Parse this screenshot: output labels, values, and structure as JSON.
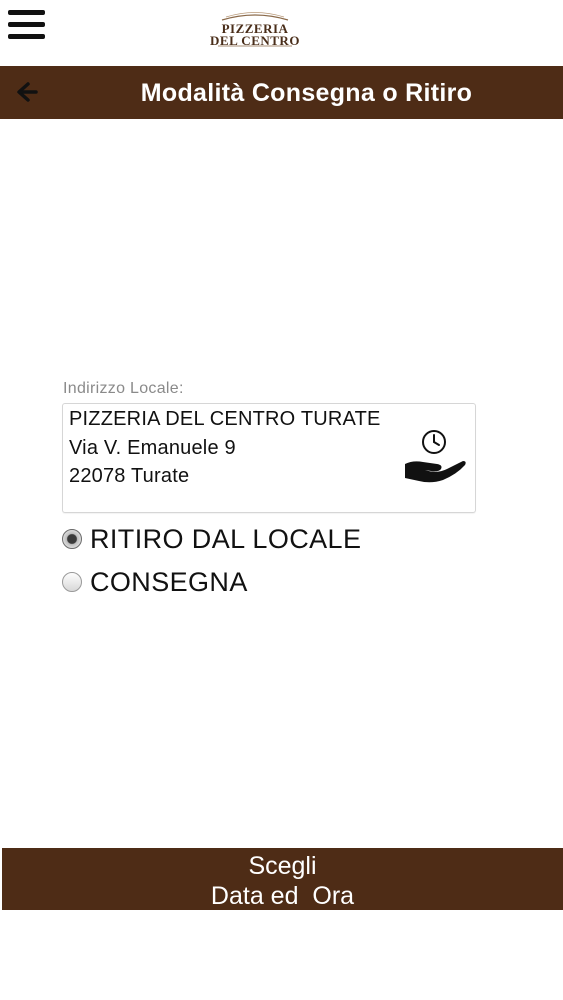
{
  "header": {
    "title": "Modalità Consegna o Ritiro",
    "back_icon": "arrow-left-icon",
    "menu_icon": "hamburger-menu-icon"
  },
  "logo": {
    "line1": "PIZZERIA",
    "line2": "DEL CENTRO"
  },
  "address": {
    "label": "Indirizzo Locale:",
    "lines": [
      "PIZZERIA DEL CENTRO TURATE",
      "Via V. Emanuele 9",
      "22078 Turate"
    ],
    "icon": "hand-clock-pickup-icon"
  },
  "options": [
    {
      "label": "RITIRO DAL LOCALE",
      "selected": true
    },
    {
      "label": "CONSEGNA",
      "selected": false
    }
  ],
  "action": {
    "line1": "Scegli",
    "line2": "Data ed  Ora"
  },
  "colors": {
    "brand_brown": "#4e2c16",
    "text": "#111111",
    "label_gray": "#8a8a8a"
  }
}
